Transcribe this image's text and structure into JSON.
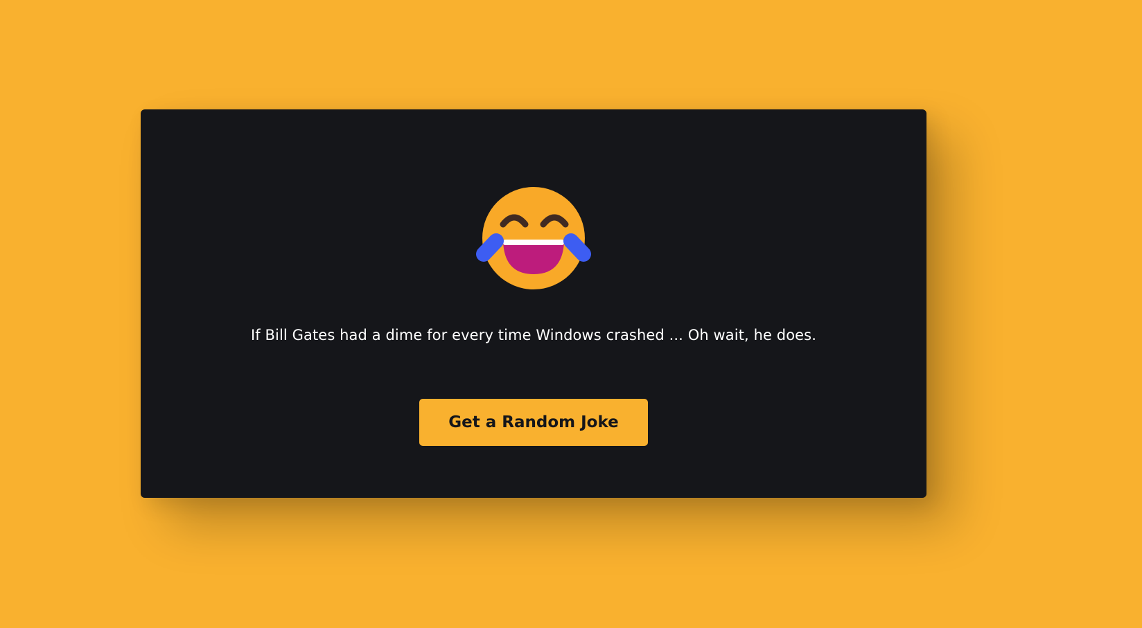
{
  "theme": {
    "background": "#F9B12F",
    "card": "#15161A",
    "accent": "#F9B12F",
    "text": "#FFFFFF"
  },
  "emoji": {
    "icon": "face-with-tears-of-joy-icon"
  },
  "joke": {
    "text": "If Bill Gates had a dime for every time Windows crashed ... Oh wait, he does."
  },
  "button": {
    "label": "Get a Random Joke"
  }
}
